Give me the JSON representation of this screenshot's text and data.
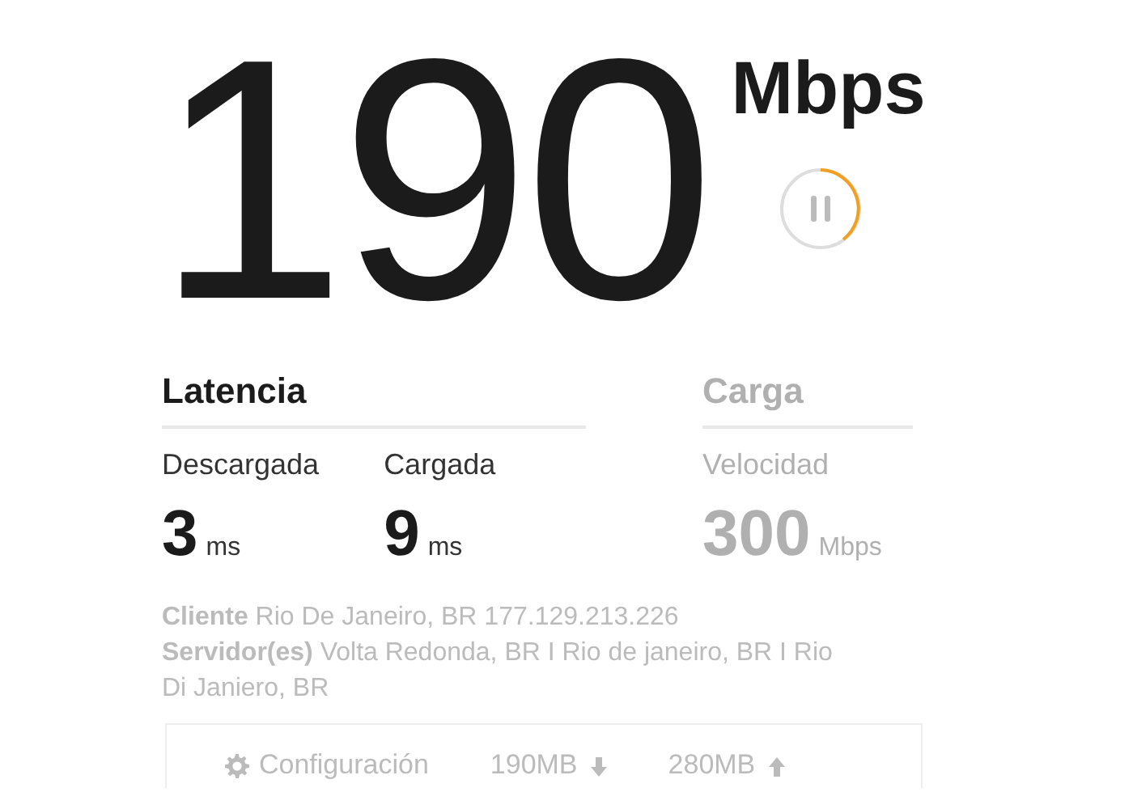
{
  "speed": {
    "value": "190",
    "unit": "Mbps"
  },
  "sections": [
    {
      "title": "Latencia",
      "active": true,
      "metrics": [
        {
          "label": "Descargada",
          "value": "3",
          "unit": "ms"
        },
        {
          "label": "Cargada",
          "value": "9",
          "unit": "ms"
        }
      ]
    },
    {
      "title": "Carga",
      "active": false,
      "metrics": [
        {
          "label": "Velocidad",
          "value": "300",
          "unit": "Mbps"
        }
      ]
    }
  ],
  "info": [
    {
      "label": "Cliente",
      "text": "Rio De Janeiro, BR   177.129.213.226"
    },
    {
      "label": "Servidor(es)",
      "text": "Volta Redonda, BR  I  Rio de janeiro, BR  I  Rio Di Janiero, BR"
    }
  ],
  "footer": {
    "settings": "Configuración",
    "download": "190MB",
    "upload": "280MB"
  }
}
